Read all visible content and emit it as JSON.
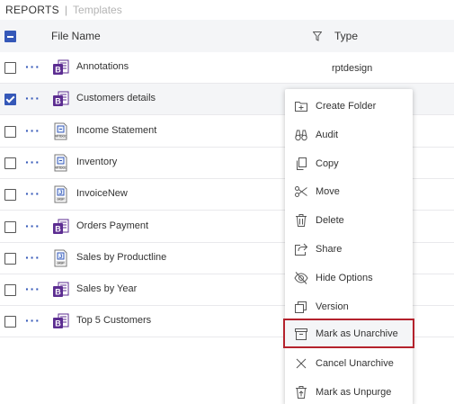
{
  "breadcrumb": {
    "reports_label": "REPORTS",
    "separator": "|",
    "templates_label": "Templates"
  },
  "table": {
    "header": {
      "file_name_label": "File Name",
      "type_label": "Type",
      "filter_icon": "filter-icon",
      "select_all_state": "indeterminate"
    },
    "rows": [
      {
        "name": "Annotations",
        "type": "rptdesign",
        "icon": "birt-design-icon",
        "checked": false
      },
      {
        "name": "Customers details",
        "type": "",
        "icon": "birt-design-icon",
        "checked": true
      },
      {
        "name": "Income Statement",
        "type": "",
        "icon": "rptdoc-file-icon",
        "checked": false
      },
      {
        "name": "Inventory",
        "type": "",
        "icon": "rptdoc-file-icon",
        "checked": false
      },
      {
        "name": "InvoiceNew",
        "type": "",
        "icon": "jasper-file-icon",
        "checked": false
      },
      {
        "name": "Orders Payment",
        "type": "",
        "icon": "birt-design-icon",
        "checked": false
      },
      {
        "name": "Sales by Productline",
        "type": "",
        "icon": "jasper-file-icon",
        "checked": false
      },
      {
        "name": "Sales by Year",
        "type": "",
        "icon": "birt-design-icon",
        "checked": false
      },
      {
        "name": "Top 5 Customers",
        "type": "",
        "icon": "birt-design-icon",
        "checked": false
      }
    ],
    "more_label": "···"
  },
  "context_menu": {
    "items": [
      {
        "label": "Create Folder",
        "icon": "folder-plus-icon"
      },
      {
        "label": "Audit",
        "icon": "binoculars-icon"
      },
      {
        "label": "Copy",
        "icon": "copy-icon"
      },
      {
        "label": "Move",
        "icon": "scissors-icon"
      },
      {
        "label": "Delete",
        "icon": "trash-icon"
      },
      {
        "label": "Share",
        "icon": "share-icon"
      },
      {
        "label": "Hide Options",
        "icon": "eye-slash-icon"
      },
      {
        "label": "Version",
        "icon": "version-icon"
      },
      {
        "label": "Mark as Unarchive",
        "icon": "archive-box-icon",
        "highlighted": true
      },
      {
        "label": "Cancel Unarchive",
        "icon": "close-icon"
      },
      {
        "label": "Mark as Unpurge",
        "icon": "trash-restore-icon"
      }
    ]
  },
  "colors": {
    "accent": "#3558b8",
    "birt_purple": "#5c2d91",
    "highlight_border": "#b4222c",
    "row_selected": "#f4f5f7"
  }
}
